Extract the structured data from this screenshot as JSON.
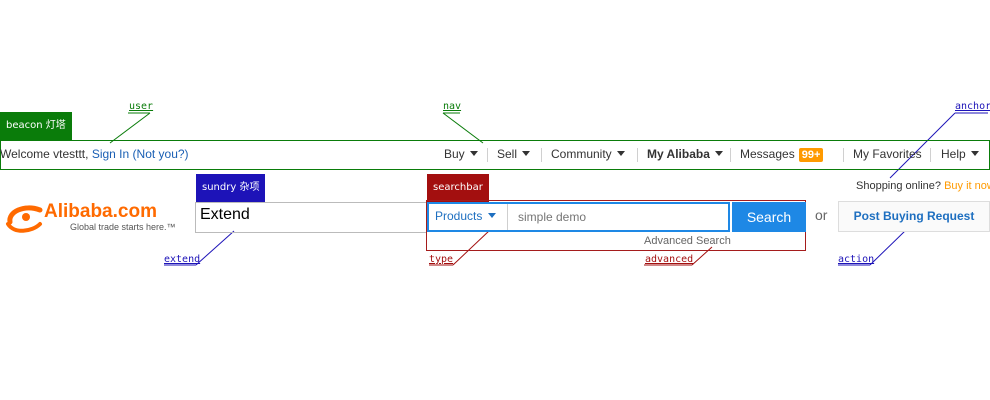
{
  "annotations": {
    "user": "user",
    "nav": "nav",
    "anchor": "anchor",
    "extend": "extend",
    "type": "type",
    "advanced": "advanced",
    "action": "action"
  },
  "tags": {
    "beacon": "beacon 灯塔",
    "sundry": "sundry 杂项",
    "searchbar": "searchbar"
  },
  "colors": {
    "beacon": "#0a7c0a",
    "sundry": "#1d13b8",
    "searchbar": "#a30f0f",
    "brand": "#ff6a00",
    "search_blue": "#1e88e5"
  },
  "user": {
    "welcome": "Welcome vtesttt,",
    "sign_in": "Sign In",
    "not_you": "(Not you?)"
  },
  "nav": {
    "buy": "Buy",
    "sell": "Sell",
    "community": "Community",
    "my_alibaba": "My Alibaba",
    "messages": "Messages",
    "messages_badge": "99+",
    "favorites": "My Favorites",
    "help": "Help"
  },
  "logo": {
    "name": "Alibaba.com",
    "tagline": "Global trade starts here.™"
  },
  "extend": {
    "text": "Extend"
  },
  "search": {
    "type_label": "Products",
    "placeholder": "simple demo",
    "button": "Search",
    "advanced": "Advanced Search"
  },
  "or_text": "or",
  "action": {
    "label": "Post Buying Request"
  },
  "anchor": {
    "prefix": "Shopping online?",
    "link": "Buy it now"
  }
}
